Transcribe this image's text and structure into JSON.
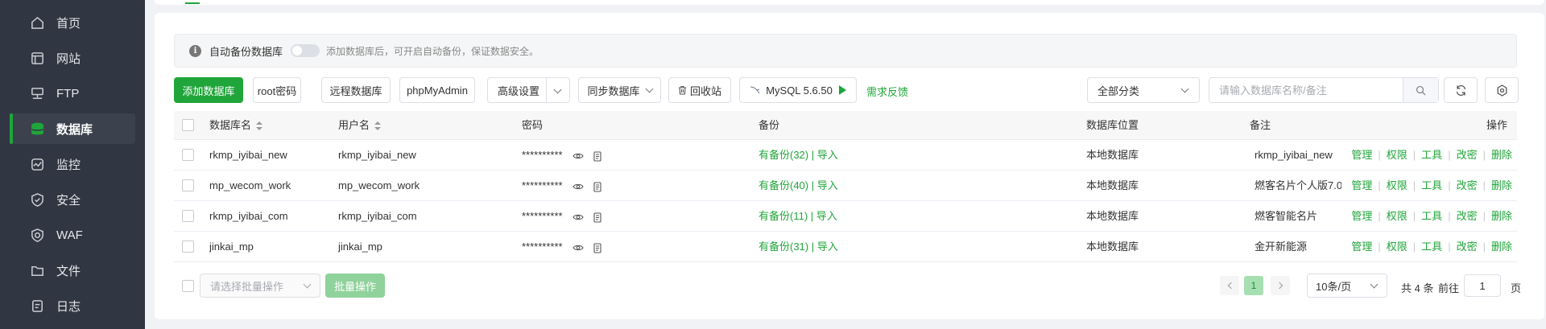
{
  "sidebar": {
    "items": [
      {
        "label": "首页",
        "icon": "home-icon"
      },
      {
        "label": "网站",
        "icon": "website-icon"
      },
      {
        "label": "FTP",
        "icon": "ftp-icon"
      },
      {
        "label": "数据库",
        "icon": "database-icon",
        "active": true
      },
      {
        "label": "监控",
        "icon": "monitor-icon"
      },
      {
        "label": "安全",
        "icon": "shield-icon"
      },
      {
        "label": "WAF",
        "icon": "waf-icon"
      },
      {
        "label": "文件",
        "icon": "folder-icon"
      },
      {
        "label": "日志",
        "icon": "log-icon"
      }
    ]
  },
  "notice": {
    "label": "自动备份数据库",
    "hint": "添加数据库后，可开启自动备份，保证数据安全。"
  },
  "toolbar": {
    "add": "添加数据库",
    "root_password": "root密码",
    "remote_db": "远程数据库",
    "phpmyadmin": "phpMyAdmin",
    "advanced": "高级设置",
    "sync": "同步数据库",
    "recycle": "回收站",
    "mysql_version": "MySQL 5.6.50",
    "feedback": "需求反馈",
    "category": "全部分类",
    "search_placeholder": "请输入数据库名称/备注"
  },
  "table": {
    "headers": {
      "name": "数据库名",
      "user": "用户名",
      "password": "密码",
      "backup": "备份",
      "location": "数据库位置",
      "remark": "备注",
      "ops": "操作"
    },
    "rows": [
      {
        "name": "rkmp_iyibai_new",
        "user": "rkmp_iyibai_new",
        "password": "**********",
        "backup": "有备份(32) | 导入",
        "location": "本地数据库",
        "remark": "rkmp_iyibai_new"
      },
      {
        "name": "mp_wecom_work",
        "user": "mp_wecom_work",
        "password": "**********",
        "backup": "有备份(40) | 导入",
        "location": "本地数据库",
        "remark": "燃客名片个人版7.0"
      },
      {
        "name": "rkmp_iyibai_com",
        "user": "rkmp_iyibai_com",
        "password": "**********",
        "backup": "有备份(11) | 导入",
        "location": "本地数据库",
        "remark": "燃客智能名片"
      },
      {
        "name": "jinkai_mp",
        "user": "jinkai_mp",
        "password": "**********",
        "backup": "有备份(31) | 导入",
        "location": "本地数据库",
        "remark": "金开新能源"
      }
    ],
    "actions": {
      "manage": "管理",
      "perm": "权限",
      "tools": "工具",
      "changepw": "改密",
      "delete": "删除"
    }
  },
  "footer": {
    "batch_placeholder": "请选择批量操作",
    "batch_btn": "批量操作",
    "page": "1",
    "page_size": "10条/页",
    "total": "共 4 条",
    "goto": "前往",
    "goto_value": "1",
    "page_unit": "页"
  },
  "colors": {
    "accent": "#20a53a",
    "sidebar": "#303642"
  }
}
